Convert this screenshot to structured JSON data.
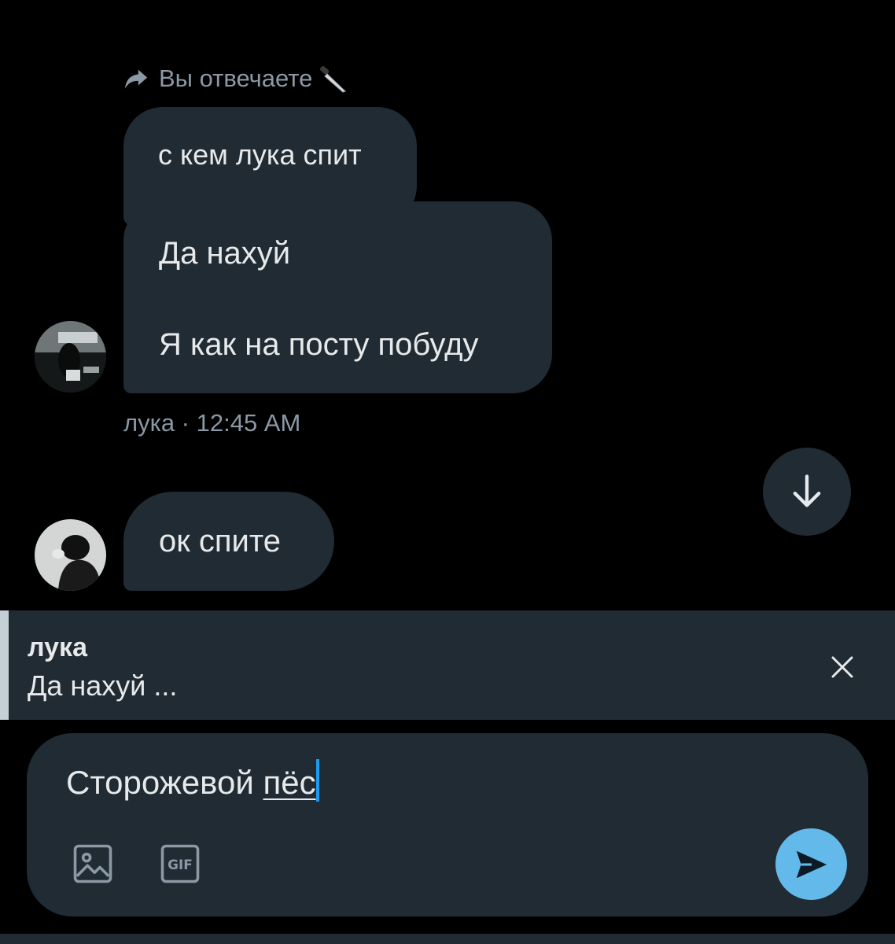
{
  "reply_context": {
    "label": "Вы отвечаете"
  },
  "messages": [
    {
      "text": "с кем лука спит",
      "type": "quoted"
    },
    {
      "lines": [
        "Да нахуй",
        "Я как на посту побуду"
      ],
      "type": "received"
    },
    {
      "text": "ок спите",
      "type": "received"
    }
  ],
  "meta": "лука · 12:45 AM",
  "reply_banner": {
    "name": "лука",
    "text": "Да нахуй ..."
  },
  "composer": {
    "text_plain": "Сторожевой ",
    "text_underlined": "пёс"
  },
  "colors": {
    "background": "#000000",
    "bubble": "#202b33",
    "secondary_text": "#8b98a5",
    "accent": "#1d9bf0",
    "send_button": "#63b9ea"
  },
  "icons": {
    "reply_context": "reply-arrow-icon",
    "emoji": "knife-emoji-icon",
    "scroll": "arrow-down-icon",
    "close": "close-icon",
    "media": "image-icon",
    "gif": "gif-icon",
    "send": "send-icon"
  }
}
